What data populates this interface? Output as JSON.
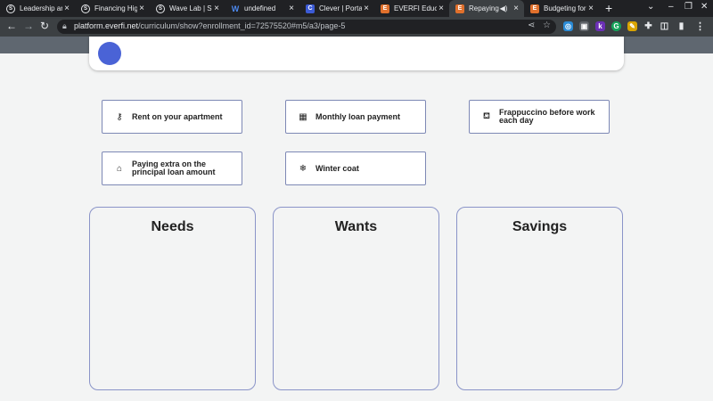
{
  "browser": {
    "tabs": [
      {
        "icon": "s",
        "title": "Leadership an"
      },
      {
        "icon": "s",
        "title": "Financing Hig"
      },
      {
        "icon": "s",
        "title": "Wave Lab | Sc"
      },
      {
        "icon": "w",
        "title": "undefined"
      },
      {
        "icon": "c",
        "title": "Clever | Portal"
      },
      {
        "icon": "e",
        "title": "EVERFI Educa"
      },
      {
        "icon": "e",
        "title": "Repaying"
      },
      {
        "icon": "e",
        "title": "Budgeting for"
      }
    ],
    "url_domain": "platform.everfi.net",
    "url_path": "/curriculum/show?enrollment_id=72575520#m5/a3/page-5",
    "new_tab": "+"
  },
  "items": [
    {
      "label": "Rent on your apartment",
      "icon": "key-icon",
      "glyph": "⚷"
    },
    {
      "label": "Monthly loan payment",
      "icon": "calendar-icon",
      "glyph": "▦"
    },
    {
      "label": "Frappuccino before work each day",
      "icon": "cup-icon",
      "glyph": "⛾"
    },
    {
      "label": "Paying extra on the principal loan amount",
      "icon": "bank-icon",
      "glyph": "⌂"
    },
    {
      "label": "Winter coat",
      "icon": "snowflake-icon",
      "glyph": "❄"
    }
  ],
  "buckets": [
    {
      "title": "Needs"
    },
    {
      "title": "Wants"
    },
    {
      "title": "Savings"
    }
  ],
  "colors": {
    "accent": "#4a63d6",
    "border": "#8a94c8"
  }
}
